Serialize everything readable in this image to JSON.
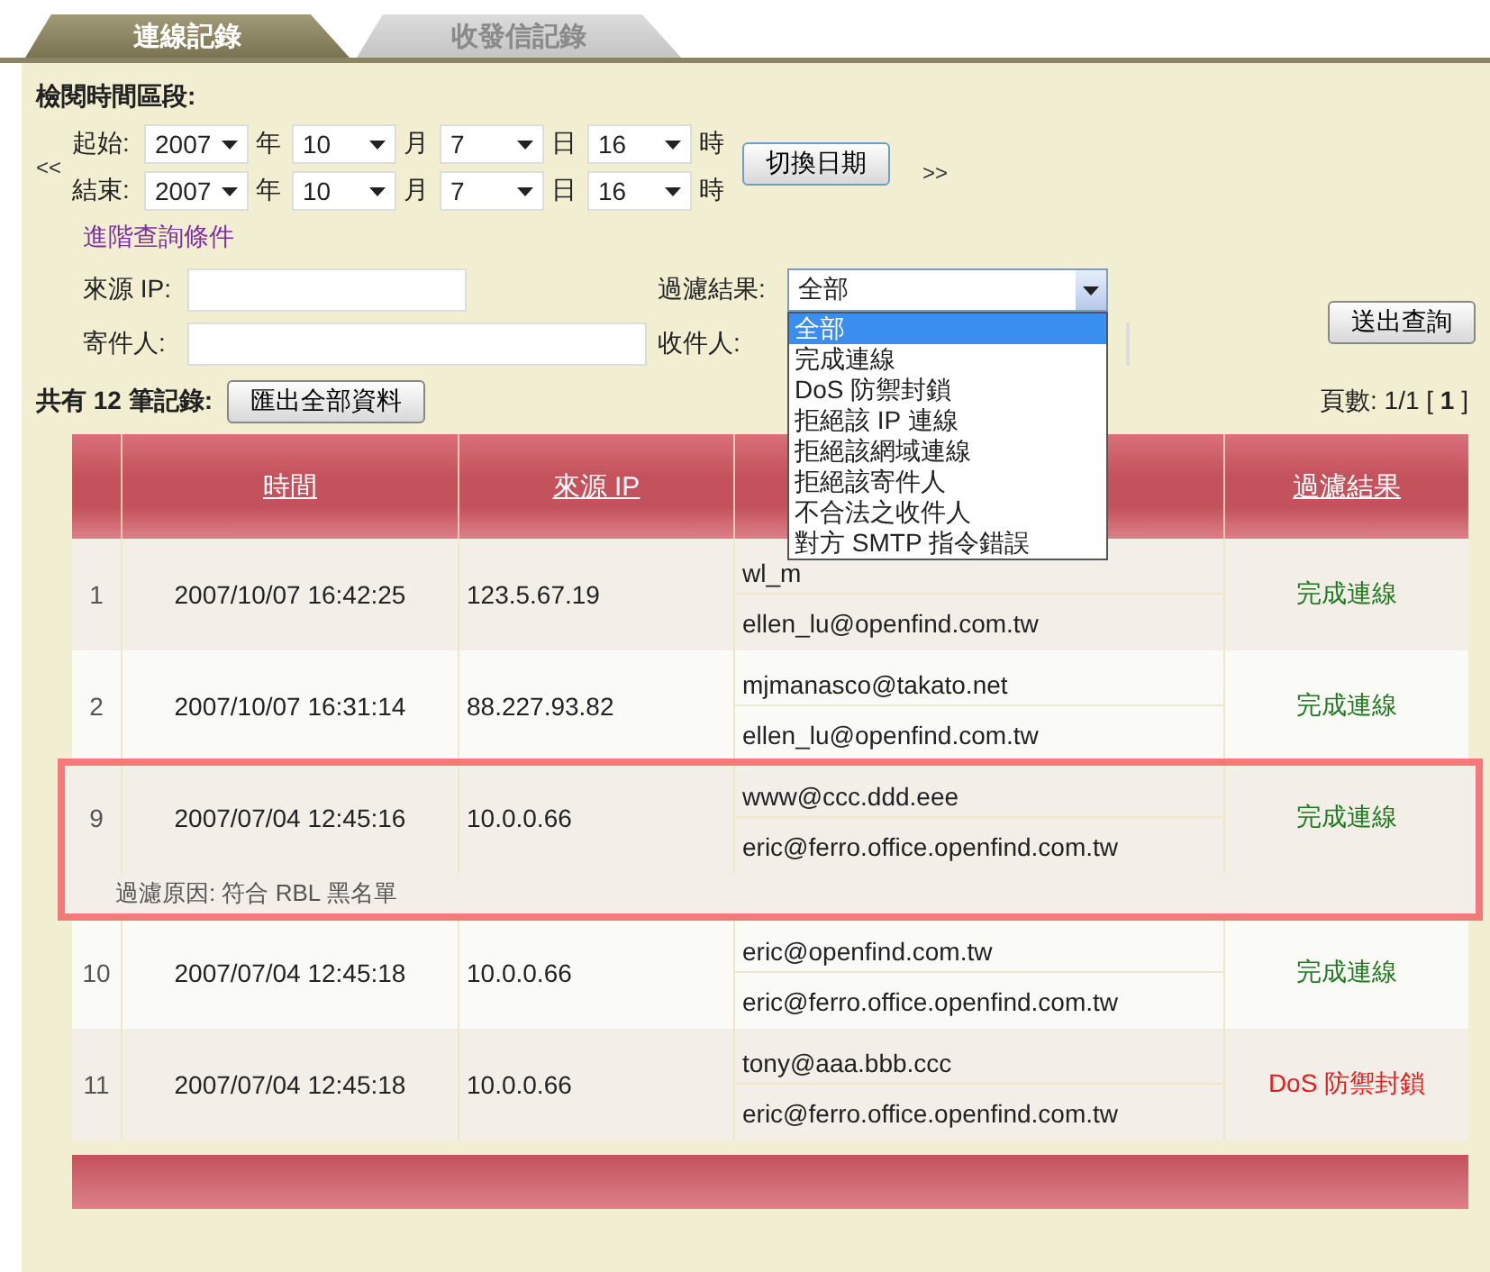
{
  "tabs": [
    {
      "label": "連線記錄",
      "selected": true
    },
    {
      "label": "收發信記錄",
      "selected": false
    }
  ],
  "period": {
    "heading": "檢閱時間區段:",
    "prev": "<<",
    "next": ">>",
    "switch_button": "切換日期",
    "rows": [
      {
        "label": "起始:",
        "fields": [
          {
            "value": "2007",
            "unit": "年"
          },
          {
            "value": "10",
            "unit": "月"
          },
          {
            "value": "7",
            "unit": "日"
          },
          {
            "value": "16",
            "unit": "時"
          }
        ]
      },
      {
        "label": "結束:",
        "fields": [
          {
            "value": "2007",
            "unit": "年"
          },
          {
            "value": "10",
            "unit": "月"
          },
          {
            "value": "7",
            "unit": "日"
          },
          {
            "value": "16",
            "unit": "時"
          }
        ]
      }
    ]
  },
  "advanced_link": "進階查詢條件",
  "filters": {
    "source_ip_label": "來源 IP:",
    "sender_label": "寄件人:",
    "result_label": "過濾結果:",
    "result_value": "全部",
    "recipient_label": "收件人:",
    "submit_button": "送出查詢",
    "result_dropdown": {
      "expanded": true,
      "options": [
        {
          "label": "全部",
          "selected": true
        },
        {
          "label": "完成連線",
          "selected": false
        },
        {
          "label": "DoS 防禦封鎖",
          "selected": false
        },
        {
          "label": "拒絕該 IP 連線",
          "selected": false
        },
        {
          "label": "拒絕該網域連線",
          "selected": false
        },
        {
          "label": "拒絕該寄件人",
          "selected": false
        },
        {
          "label": "不合法之收件人",
          "selected": false
        },
        {
          "label": "對方 SMTP 指令錯誤",
          "selected": false
        }
      ]
    }
  },
  "summary": {
    "text": "共有 12 筆記錄:",
    "export_button": "匯出全部資料",
    "pages": "頁數: 1/1 [ **1** ]"
  },
  "table": {
    "columns": [
      "時間",
      "來源 IP",
      "過濾結果"
    ],
    "rows": [
      {
        "no": "1",
        "time": "2007/10/07 16:42:25",
        "ip": "123.5.67.19",
        "sender": "wl_m",
        "recipient": "ellen_lu@openfind.com.tw",
        "result": "完成連線",
        "kind": "ok",
        "highlighted": false
      },
      {
        "no": "2",
        "time": "2007/10/07 16:31:14",
        "ip": "88.227.93.82",
        "sender": "mjmanasco@takato.net",
        "recipient": "ellen_lu@openfind.com.tw",
        "result": "完成連線",
        "kind": "ok",
        "highlighted": false
      },
      {
        "no": "9",
        "time": "2007/07/04 12:45:16",
        "ip": "10.0.0.66",
        "sender": "www@ccc.ddd.eee",
        "recipient": "eric@ferro.office.openfind.com.tw",
        "result": "完成連線",
        "kind": "ok",
        "highlighted": true,
        "reason": "過濾原因: 符合 RBL 黑名單"
      },
      {
        "no": "10",
        "time": "2007/07/04 12:45:18",
        "ip": "10.0.0.66",
        "sender": "eric@openfind.com.tw",
        "recipient": "eric@ferro.office.openfind.com.tw",
        "result": "完成連線",
        "kind": "ok",
        "highlighted": false
      },
      {
        "no": "11",
        "time": "2007/07/04 12:45:18",
        "ip": "10.0.0.66",
        "sender": "tony@aaa.bbb.ccc",
        "recipient": "eric@ferro.office.openfind.com.tw",
        "result": "DoS 防禦封鎖",
        "kind": "blocked",
        "highlighted": false
      }
    ]
  }
}
